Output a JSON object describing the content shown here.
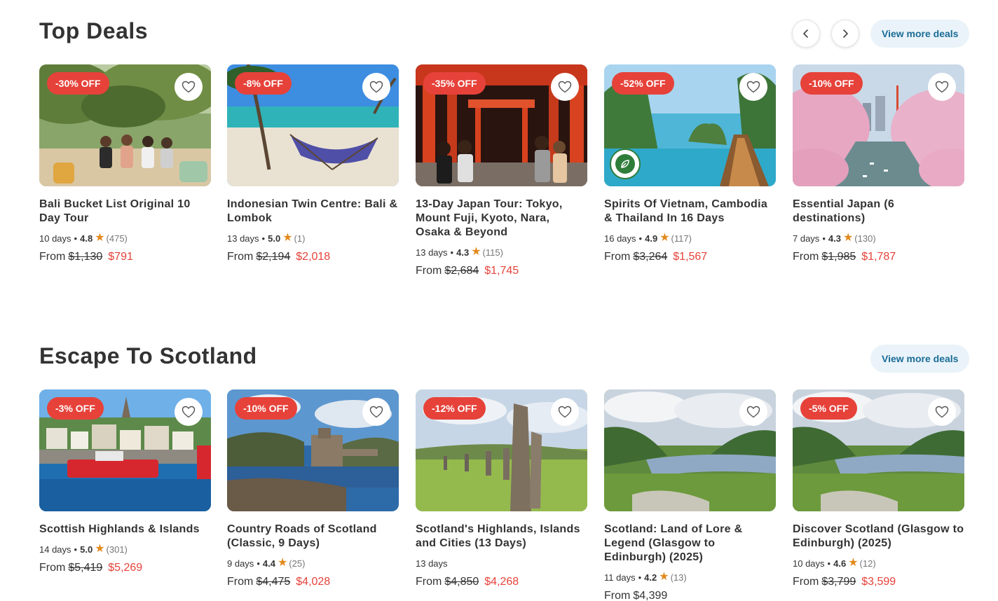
{
  "sections": [
    {
      "title": "Top Deals",
      "view_more": "View more deals",
      "cards": [
        {
          "badge": "-30% OFF",
          "title": "Bali Bucket List Original 10 Day Tour",
          "days": "10 days",
          "rating": "4.8",
          "reviews": "(475)",
          "from": "From",
          "old_price": "$1,130",
          "new_price": "$791"
        },
        {
          "badge": "-8% OFF",
          "title": "Indonesian Twin Centre: Bali & Lombok",
          "days": "13 days",
          "rating": "5.0",
          "reviews": "(1)",
          "from": "From",
          "old_price": "$2,194",
          "new_price": "$2,018"
        },
        {
          "badge": "-35% OFF",
          "title": "13-Day Japan Tour: Tokyo, Mount Fuji, Kyoto, Nara, Osaka & Beyond",
          "days": "13 days",
          "rating": "4.3",
          "reviews": "(115)",
          "from": "From",
          "old_price": "$2,684",
          "new_price": "$1,745"
        },
        {
          "badge": "-52% OFF",
          "title": "Spirits Of Vietnam, Cambodia & Thailand In 16 Days",
          "days": "16 days",
          "rating": "4.9",
          "reviews": "(117)",
          "from": "From",
          "old_price": "$3,264",
          "new_price": "$1,567"
        },
        {
          "badge": "-10% OFF",
          "title": "Essential Japan (6 destinations)",
          "days": "7 days",
          "rating": "4.3",
          "reviews": "(130)",
          "from": "From",
          "old_price": "$1,985",
          "new_price": "$1,787"
        }
      ]
    },
    {
      "title": "Escape To Scotland",
      "view_more": "View more deals",
      "cards": [
        {
          "badge": "-3% OFF",
          "title": "Scottish Highlands & Islands",
          "days": "14 days",
          "rating": "5.0",
          "reviews": "(301)",
          "from": "From",
          "old_price": "$5,419",
          "new_price": "$5,269"
        },
        {
          "badge": "-10% OFF",
          "title": "Country Roads of Scotland (Classic, 9 Days)",
          "days": "9 days",
          "rating": "4.4",
          "reviews": "(25)",
          "from": "From",
          "old_price": "$4,475",
          "new_price": "$4,028"
        },
        {
          "badge": "-12% OFF",
          "title": "Scotland's Highlands, Islands and Cities (13 Days)",
          "days": "13 days",
          "rating": "",
          "reviews": "",
          "from": "From",
          "old_price": "$4,850",
          "new_price": "$4,268"
        },
        {
          "badge": "",
          "title": "Scotland: Land of Lore & Legend (Glasgow to Edinburgh) (2025)",
          "days": "11 days",
          "rating": "4.2",
          "reviews": "(13)",
          "from": "From",
          "old_price": "",
          "new_price": "",
          "price_plain": "$4,399"
        },
        {
          "badge": "-5% OFF",
          "title": "Discover Scotland (Glasgow to Edinburgh) (2025)",
          "days": "10 days",
          "rating": "4.6",
          "reviews": "(12)",
          "from": "From",
          "old_price": "$3,799",
          "new_price": "$3,599"
        }
      ]
    }
  ],
  "icons": {
    "prev": "chevron-left-icon",
    "next": "chevron-right-icon",
    "wishlist": "heart-icon",
    "star": "star-icon",
    "eco": "leaf-icon"
  },
  "colors": {
    "badge": "#e6423a",
    "sale_price": "#e6423a",
    "star": "#e28a1d",
    "view_more_bg": "#e9f3f9",
    "view_more_text": "#1b6c95"
  }
}
